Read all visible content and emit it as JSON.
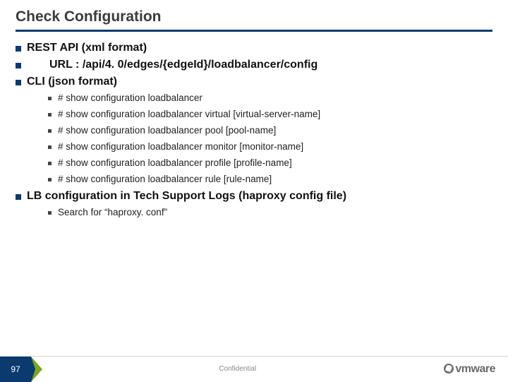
{
  "title": "Check Configuration",
  "sections": [
    {
      "heading": "REST API (xml format)"
    }
  ],
  "url_label": "URL : /api/4. 0/edges/{edgeId}/loadbalancer/config",
  "cli_heading": "CLI (json format)",
  "cli_items": [
    "# show configuration loadbalancer",
    "# show configuration loadbalancer virtual [virtual-server-name]",
    "# show configuration loadbalancer pool [pool-name]",
    "# show configuration loadbalancer monitor [monitor-name]",
    "# show configuration loadbalancer profile [profile-name]",
    "# show configuration loadbalancer rule [rule-name]"
  ],
  "lb_heading": "LB configuration in Tech Support Logs (haproxy config file)",
  "lb_items": [
    "Search for “haproxy. conf”"
  ],
  "footer": {
    "page": "97",
    "confidential": "Confidential",
    "logo_text": "vmware"
  }
}
